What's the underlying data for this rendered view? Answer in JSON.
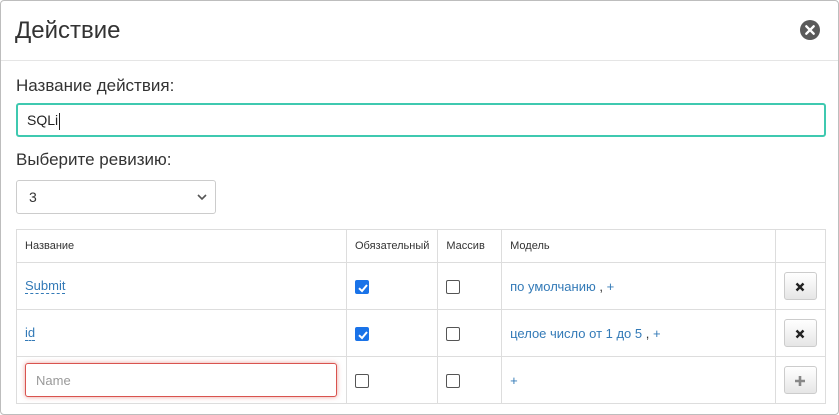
{
  "dialog": {
    "title": "Действие"
  },
  "form": {
    "name_label": "Название действия:",
    "name_value": "SQLi",
    "revision_label": "Выберите ревизию:",
    "revision_value": "3"
  },
  "table": {
    "headers": [
      "Название",
      "Обязательный",
      "Массив",
      "Модель",
      ""
    ],
    "rows": [
      {
        "name": "Submit",
        "required": true,
        "array": false,
        "model": "по умолчанию",
        "comma": ",",
        "plus": "+"
      },
      {
        "name": "id",
        "required": true,
        "array": false,
        "model": "целое число от 1 до 5",
        "comma": ",",
        "plus": "+"
      }
    ],
    "new_row": {
      "name_placeholder": "Name",
      "required": false,
      "array": false,
      "plus": "+"
    }
  },
  "icons": {
    "close": "close-circle-icon",
    "remove": "remove-x-icon",
    "add": "plus-icon",
    "select": "chevron-down-icon",
    "check": "checkmark-icon"
  },
  "colors": {
    "accent_input": "#3fc9b0",
    "link": "#337ab7",
    "error": "#d9534f",
    "checkbox": "#1a73e8"
  }
}
